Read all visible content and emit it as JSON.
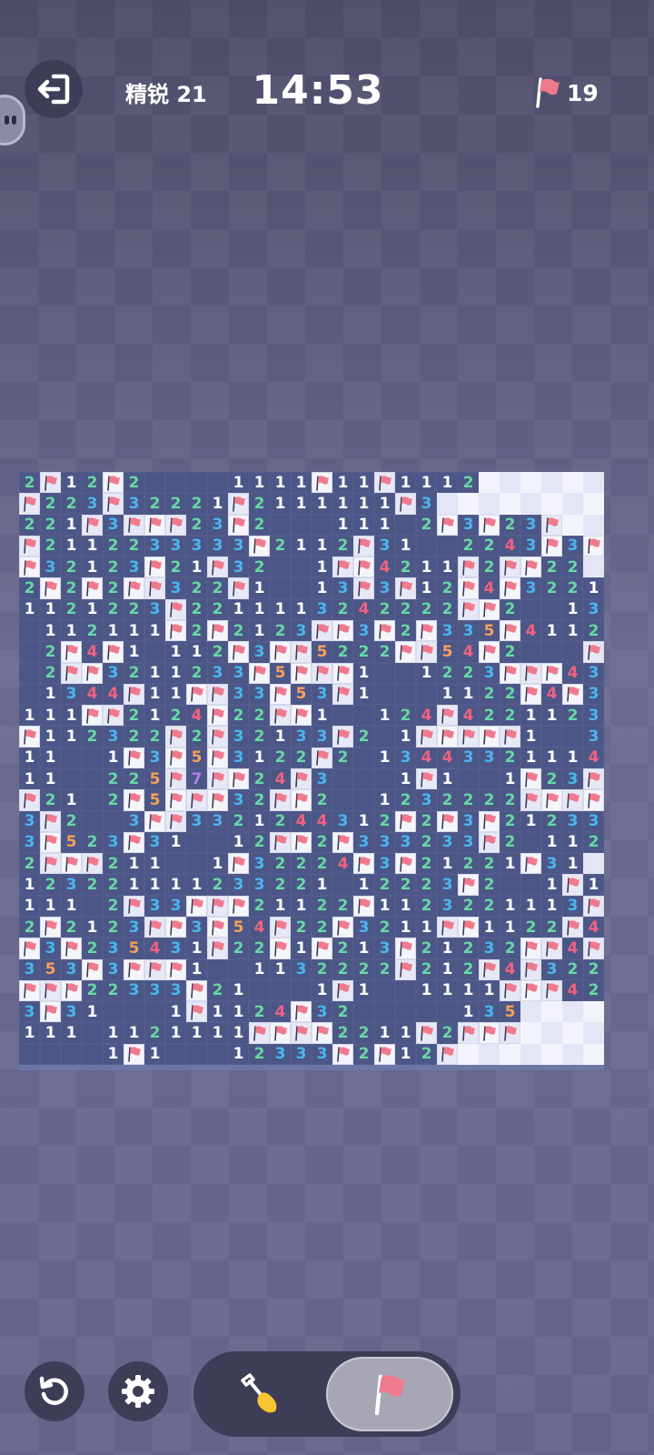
{
  "header": {
    "exit_icon": "exit-icon",
    "difficulty_label": "精锐 21",
    "timer": "14:53",
    "flag_icon": "flag-icon",
    "flags_remaining": "19"
  },
  "board": {
    "rows": 28,
    "cols": 28,
    "legend": "char key: . = revealed empty, 1-8 = revealed number, F = flagged, # = unrevealed",
    "grid": [
      "2F12F2....1111F11F1112######",
      "F223F32221F2111111F3########",
      "221F3FFF23F2...111.2F3F23F##",
      "F2112233333F2112F31..2243F3F#",
      "F32123F21F32..1FF4211F2FF22#",
      "2F2F2FF322F1..13F3F12F4F3221#",
      "1121223F2211113242222FF2..13#",
      ".112111F2F2123FF3F2F335F4112F",
      ".2F4F1.112F3FF5222FF54F2...F##",
      ".2FF3211233F5FFF1..1223FFF43##",
      ".1344F11FF33F53F1...1122F4F3F4",
      "111FF2124F22FF1..124F4221123F#",
      "F112322F2F32133F2.1FFFFF1..3F#",
      "11..1F3F5F3122F2.13443321114F#",
      "11..225F7FF24F3...1F1..1F23FF",
      "F21.2F5FFF32FF2..1232222FFFF3",
      "3F2..3FF3321244312F2F3F21233F2",
      "3F523F31..12FF2F333233F2.112F",
      "2FFF211..1F32224F3F21221F31#",
      "123221111233221.12223F2..1F12FF31",
      "111.2F33FFF21122F1123221113F2",
      "2F2123FF3F54F22F3211FF1122F4F4",
      "F3F235431F22F1F213F21232FF4FF",
      "353F3FFF1..1132222F212F4F322F#",
      "FFF22333F21...1F1..1111FFF4222F32",
      "3F31...1F1124F32.....135#######",
      "111.1121111FFFF2211F2FFF#######",
      "....1F1...12333F2F12F#########"
    ]
  }
}
